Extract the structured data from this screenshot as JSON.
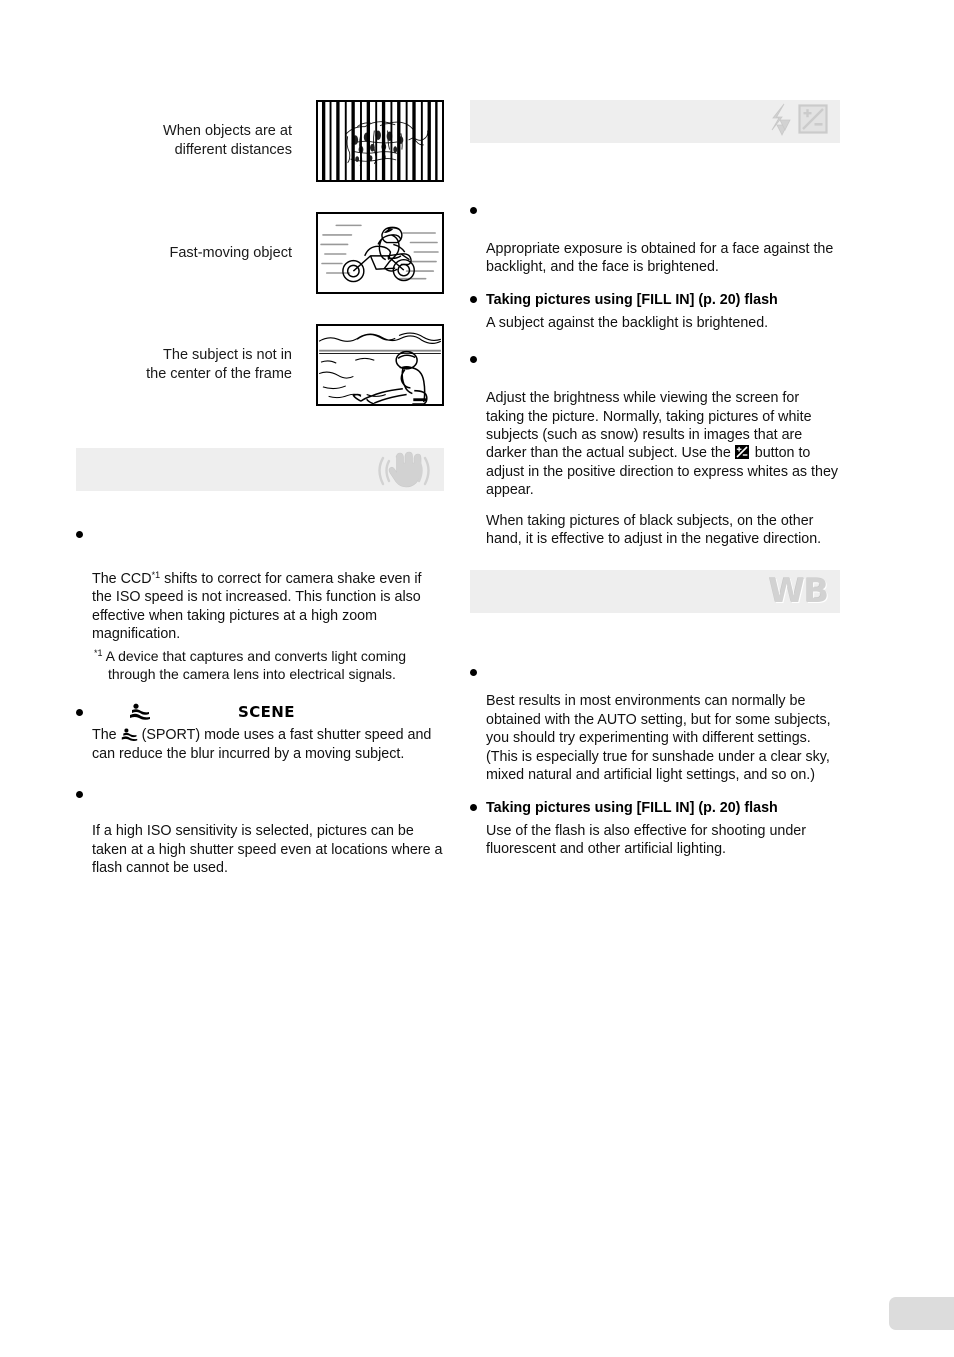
{
  "document": {
    "type": "camera-manual-page"
  },
  "left_column": {
    "illustrations": [
      {
        "label": "When objects are at\ndifferent distances",
        "icon": "caged-animal-illustration"
      },
      {
        "label": "Fast-moving object",
        "icon": "motorcycle-illustration"
      },
      {
        "label": "The subject is not in\nthe center of the frame",
        "icon": "off-center-subject-illustration"
      }
    ],
    "section": {
      "header_icon": "image-stabilization-icon",
      "header_label": "",
      "blocks": [
        {
          "bullet_label": "",
          "paragraph": "The CCD*1 shifts to correct for camera shake even if the ISO speed is not increased. This function is also effective when taking pictures at a high zoom magnification.",
          "paragraph_parts": {
            "a": "The CCD",
            "sup": "*1",
            "b": " shifts to correct for camera shake even if the ISO speed is not increased. This function is also effective when taking pictures at a high zoom magnification."
          },
          "footnote_marker": "*1",
          "footnote": "A device that captures and converts light coming through the camera lens into electrical signals."
        },
        {
          "bullet_label": "",
          "scene_word": "SCENE",
          "scene_icon": "sport-mode-icon",
          "paragraph_parts": {
            "a": "The ",
            "icon": "sport-mode-icon",
            "b": " (SPORT) mode uses a fast shutter speed and can reduce the blur incurred by a moving subject."
          }
        },
        {
          "bullet_label": "",
          "paragraph": "If a high ISO sensitivity is selected, pictures can be taken at a high shutter speed even at locations where a flash cannot be used."
        }
      ]
    }
  },
  "right_column": {
    "sections": [
      {
        "header_icons": [
          "flash-icon",
          "exposure-compensation-icon"
        ],
        "header_label": "",
        "blocks": [
          {
            "bullet_label": "",
            "paragraph": "Appropriate exposure is obtained for a face against the backlight, and the face is brightened."
          },
          {
            "bullet_label": "Taking pictures using [FILL IN] (p. 20) flash",
            "paragraph": "A subject against the backlight is brightened."
          },
          {
            "bullet_label": "",
            "paragraph_parts": {
              "a": "Adjust the brightness while viewing the screen for taking the picture. Normally, taking pictures of white subjects (such as snow) results in images that are darker than the actual subject. Use the ",
              "icon": "exposure-compensation-button-icon",
              "b": " button to adjust in the positive direction to express whites as they appear."
            },
            "paragraph2": "When taking pictures of black subjects, on the other hand, it is effective to adjust in the negative direction."
          }
        ]
      },
      {
        "header_icons": [
          "white-balance-icon"
        ],
        "header_label": "WB",
        "blocks": [
          {
            "bullet_label": "",
            "paragraph": "Best results in most environments can normally be obtained with the AUTO setting, but for some subjects, you should try experimenting with different settings. (This is especially true for sunshade under a clear sky, mixed natural and artificial light settings, and so on.)"
          },
          {
            "bullet_label": "Taking pictures using [FILL IN] (p. 20) flash",
            "paragraph": "Use of the flash is also effective for shooting under fluorescent and other artificial lighting."
          }
        ]
      }
    ]
  },
  "colors": {
    "section_bar_bg": "#eeeeee",
    "icon_gray": "#d2d2d2",
    "page_tab": "#dcdcdc",
    "text": "#000000"
  }
}
